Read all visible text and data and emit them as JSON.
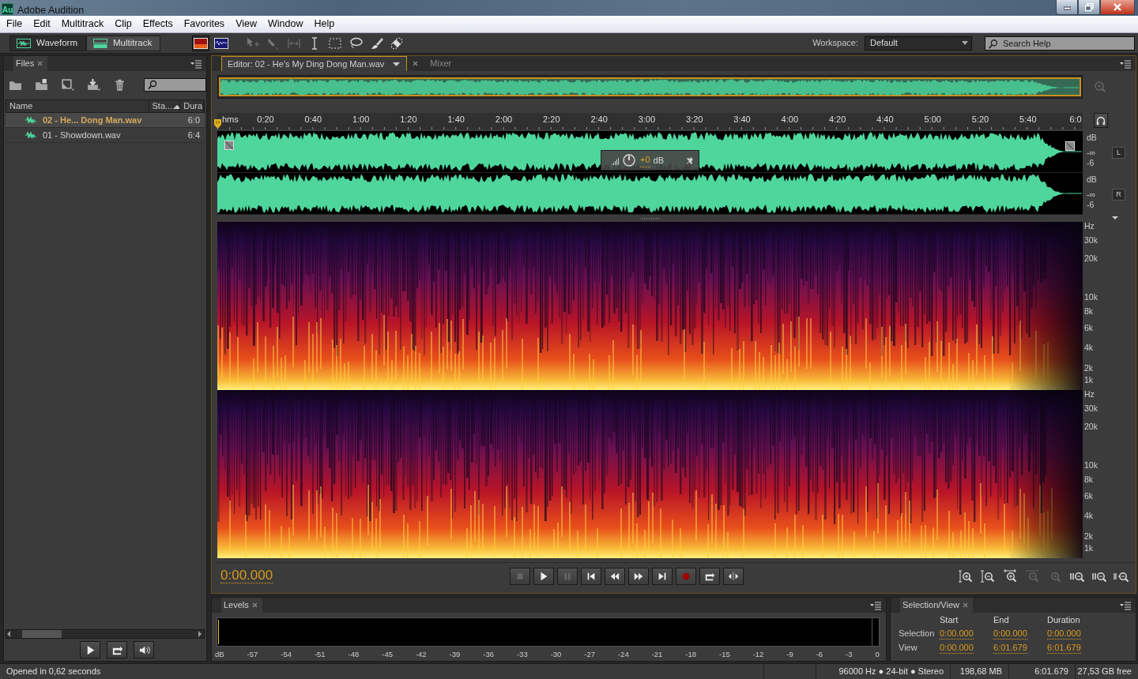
{
  "window": {
    "logo": "Au",
    "title": "Adobe Audition"
  },
  "menu": [
    "File",
    "Edit",
    "Multitrack",
    "Clip",
    "Effects",
    "Favorites",
    "View",
    "Window",
    "Help"
  ],
  "toolbar": {
    "views": [
      {
        "label": "Waveform",
        "selected": true
      },
      {
        "label": "Multitrack",
        "selected": false
      }
    ],
    "workspace_label": "Workspace:",
    "workspace": "Default",
    "search_placeholder": "Search Help"
  },
  "files_panel": {
    "title": "Files",
    "columns": [
      "Name",
      "Sta...",
      "Dura"
    ],
    "rows": [
      {
        "name": "02 - He... Dong Man.wav",
        "duration": "6:0",
        "selected": true
      },
      {
        "name": "01 - Showdown.wav",
        "duration": "6:4",
        "selected": false
      }
    ]
  },
  "editor": {
    "tabs": [
      {
        "label": "Editor: 02 - He's My Ding Dong Man.wav",
        "selected": true
      },
      {
        "label": "Mixer",
        "selected": false
      }
    ],
    "ruler": [
      "hms",
      "0:20",
      "0:40",
      "1:00",
      "1:20",
      "1:40",
      "2:00",
      "2:20",
      "2:40",
      "3:00",
      "3:20",
      "3:40",
      "4:00",
      "4:20",
      "4:40",
      "5:00",
      "5:20",
      "5:40",
      "6:0"
    ],
    "channels": [
      {
        "button": "L",
        "scale": [
          "dB",
          "-∞",
          "-6"
        ]
      },
      {
        "button": "R",
        "scale": [
          "dB",
          "-∞",
          "-6"
        ]
      }
    ],
    "hud": {
      "gain": "+0",
      "unit": "dB"
    },
    "spectral_axes": [
      {
        "labels": [
          "Hz",
          "30k",
          "20k",
          "10k",
          "8k",
          "6k",
          "4k",
          "2k",
          "1k"
        ]
      },
      {
        "labels": [
          "Hz",
          "30k",
          "20k",
          "10k",
          "8k",
          "6k",
          "4k",
          "2k",
          "1k"
        ]
      }
    ],
    "time": "0:00.000"
  },
  "levels": {
    "title": "Levels",
    "scale": [
      "dB",
      "-57",
      "-54",
      "-51",
      "-48",
      "-45",
      "-42",
      "-39",
      "-36",
      "-33",
      "-30",
      "-27",
      "-24",
      "-21",
      "-18",
      "-15",
      "-12",
      "-9",
      "-6",
      "-3",
      "0"
    ]
  },
  "selection_view": {
    "title": "Selection/View",
    "columns": [
      "Start",
      "End",
      "Duration"
    ],
    "rows": [
      {
        "label": "Selection",
        "values": [
          "0:00.000",
          "0:00.000",
          "0:00.000"
        ]
      },
      {
        "label": "View",
        "values": [
          "0:00.000",
          "6:01.679",
          "6:01.679"
        ]
      }
    ]
  },
  "status_bar": {
    "message": "Opened in 0,62 seconds",
    "items": [
      "96000 Hz ● 24-bit ● Stereo",
      "198,68 MB",
      "6:01.679",
      "27,53 GB free"
    ]
  }
}
